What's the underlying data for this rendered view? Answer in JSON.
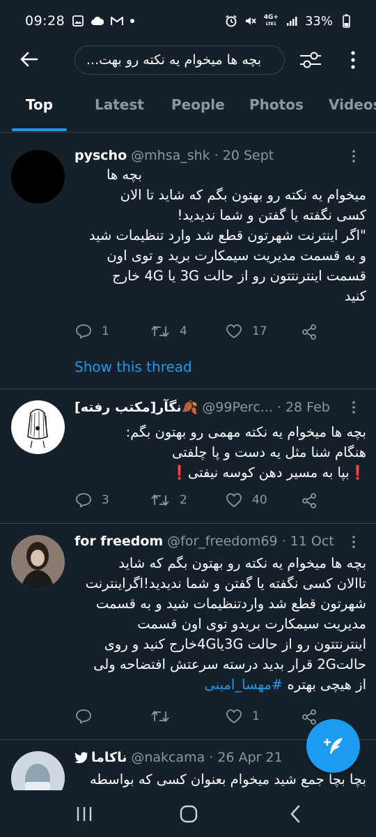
{
  "status_bar": {
    "time": "09:28",
    "network": "4G+",
    "network_sub": "LTE1",
    "battery": "33%"
  },
  "search": {
    "query": "بچه ها میخوام یه نکته رو بهت..."
  },
  "tabs": [
    {
      "label": "Top",
      "active": true
    },
    {
      "label": "Latest",
      "active": false
    },
    {
      "label": "People",
      "active": false
    },
    {
      "label": "Photos",
      "active": false
    },
    {
      "label": "Videos",
      "active": false
    }
  ],
  "tweets": [
    {
      "name": "pyscho",
      "handle": "@mhsa_shk",
      "date": "· 20 Sept",
      "lines": [
        "بچه ها",
        "میخوام یه نکته رو بهتون بگم که شاید تا الان",
        "کسی نگفته یا گفتن و شما ندیدید!",
        "\"اگر اینترنت شهرتون قطع شد وارد تنظیمات شید",
        "و به قسمت مدیریت سیمکارت برید و توی اون",
        "قسمت اینترنتتون رو از حالت 3G یا 4G خارج",
        "کنید"
      ],
      "replies": "1",
      "retweets": "4",
      "likes": "17",
      "show_thread": "Show this thread"
    },
    {
      "name": "[مکتب رفته]نگآر🍂",
      "handle": "@99Perc...",
      "date": "· 28 Feb",
      "lines": [
        "بچه ها میخوام یه نکته مهمی رو بهتون بگم:",
        "هنگام شنا مثل یه دست و پا چلفتی",
        "❗بپا به مسیر دهن کوسه نیفتی❗"
      ],
      "replies": "3",
      "retweets": "2",
      "likes": "40"
    },
    {
      "name": "for freedom",
      "handle": "@for_freedom69",
      "date": "· 11 Oct",
      "lines": [
        "بچه ها میخوام یه نکته رو بهتون بگم که شاید",
        "تاالان کسی نگفته یا گفتن و شما ندیدید!اگراینترنت",
        "شهرتون قطع شد واردتنظیمات شید و به قسمت",
        "مدیریت سیمکارت بریدو توی اون قسمت",
        "اینترنتتون رو از حالت 3Gیا4Gخارج کنید و روی",
        "حالت2G قرار بدید درسته سرعتش افتضاحه ولی"
      ],
      "last_line_text": "از هیچی بهتره",
      "hashtag": "#مهسا_امینی",
      "replies": "",
      "retweets": "",
      "likes": "1"
    },
    {
      "name": "ناکاما",
      "handle": "@nakcama",
      "date": "· 26 Apr 21",
      "lines": [
        "بچا بچا جمع شید میخوام بعنوان کسی که بواسطه"
      ]
    }
  ],
  "colors": {
    "background": "#15202b",
    "accent": "#1d9bf0",
    "secondary_text": "#8899a6",
    "divider": "#38444d"
  }
}
